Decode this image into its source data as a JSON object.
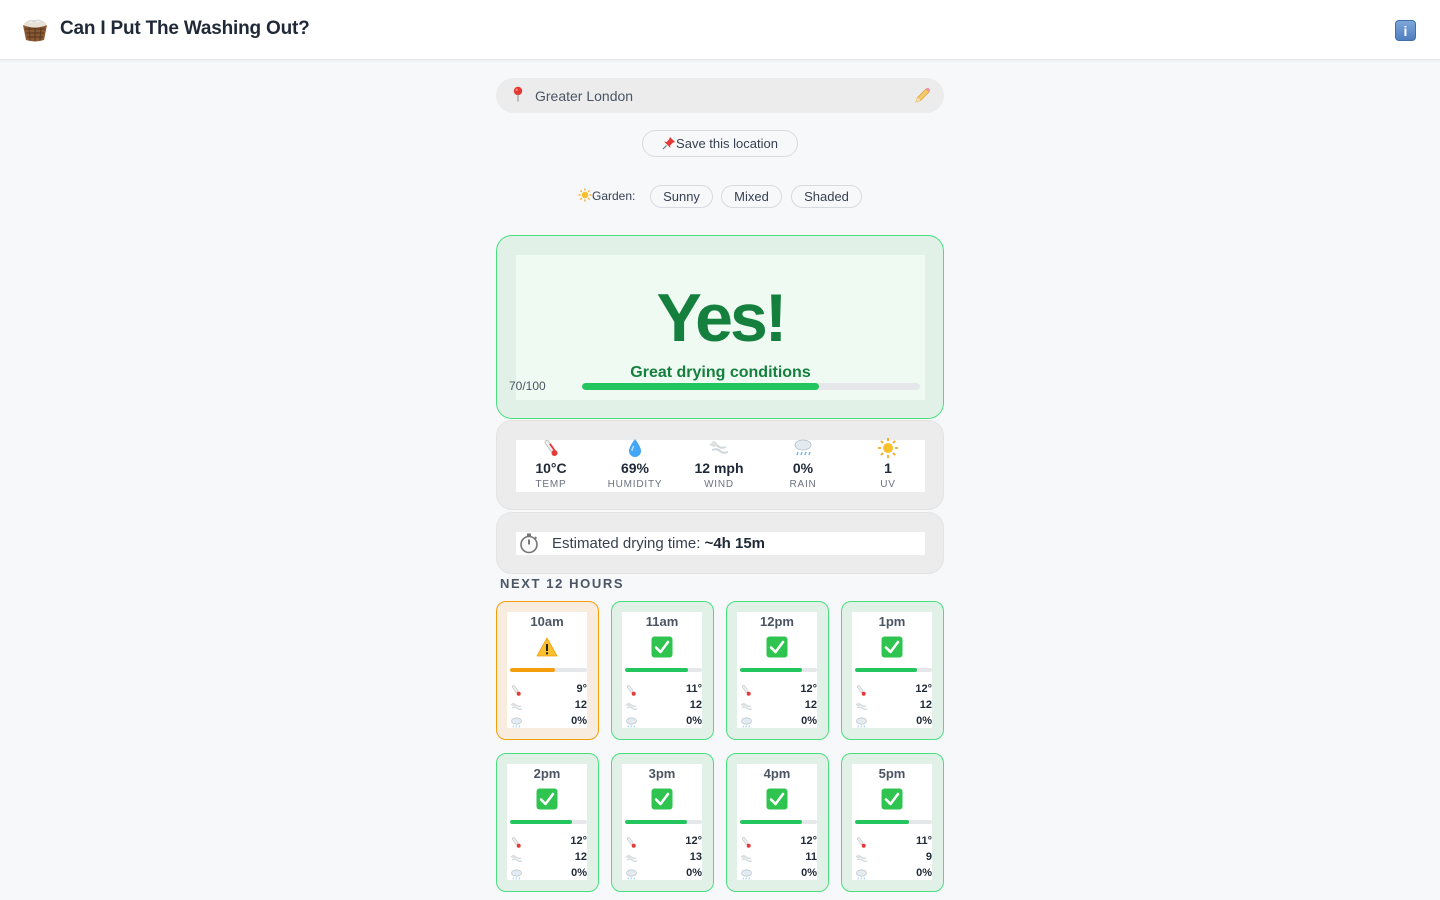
{
  "app": {
    "title": "Can I Put The Washing Out?",
    "logo_icon": "laundry-basket-icon",
    "info_icon": "info-icon",
    "info_glyph": "i"
  },
  "location": {
    "name": "Greater London",
    "pin_icon": "pin-icon",
    "edit_icon": "pencil-icon"
  },
  "save": {
    "label": "Save this location",
    "icon": "pushpin-icon"
  },
  "garden": {
    "label": "Garden:",
    "options": [
      "Sunny",
      "Mixed",
      "Shaded"
    ]
  },
  "verdict": {
    "headline": "Yes!",
    "subtitle": "Great drying conditions",
    "score_label": "70/100",
    "score": 70,
    "score_max": 100,
    "color": "#15803d"
  },
  "stats": [
    {
      "icon": "thermometer-icon",
      "value": "10°C",
      "label": "TEMP"
    },
    {
      "icon": "droplet-icon",
      "value": "69%",
      "label": "HUMIDITY"
    },
    {
      "icon": "wind-icon",
      "value": "12 mph",
      "label": "WIND"
    },
    {
      "icon": "rain-cloud-icon",
      "value": "0%",
      "label": "RAIN"
    },
    {
      "icon": "sun-icon",
      "value": "1",
      "label": "UV"
    }
  ],
  "drying": {
    "label": "Estimated drying time:",
    "value": "~4h 15m",
    "icon": "stopwatch-icon"
  },
  "forecast": {
    "title": "NEXT 12 HOURS",
    "hours": [
      {
        "time": "10am",
        "status": "warning",
        "score": 0.58,
        "temp": "9°",
        "wind": "12",
        "rain": "0%"
      },
      {
        "time": "11am",
        "status": "good",
        "score": 0.82,
        "temp": "11°",
        "wind": "12",
        "rain": "0%"
      },
      {
        "time": "12pm",
        "status": "good",
        "score": 0.8,
        "temp": "12°",
        "wind": "12",
        "rain": "0%"
      },
      {
        "time": "1pm",
        "status": "good",
        "score": 0.8,
        "temp": "12°",
        "wind": "12",
        "rain": "0%"
      },
      {
        "time": "2pm",
        "status": "good",
        "score": 0.8,
        "temp": "12°",
        "wind": "12",
        "rain": "0%"
      },
      {
        "time": "3pm",
        "status": "good",
        "score": 0.8,
        "temp": "12°",
        "wind": "13",
        "rain": "0%"
      },
      {
        "time": "4pm",
        "status": "good",
        "score": 0.8,
        "temp": "12°",
        "wind": "11",
        "rain": "0%"
      },
      {
        "time": "5pm",
        "status": "good",
        "score": 0.7,
        "temp": "11°",
        "wind": "9",
        "rain": "0%"
      }
    ]
  },
  "colors": {
    "good": "#22c55e",
    "warning": "#f59e0b",
    "good_border": "#4ade80"
  }
}
